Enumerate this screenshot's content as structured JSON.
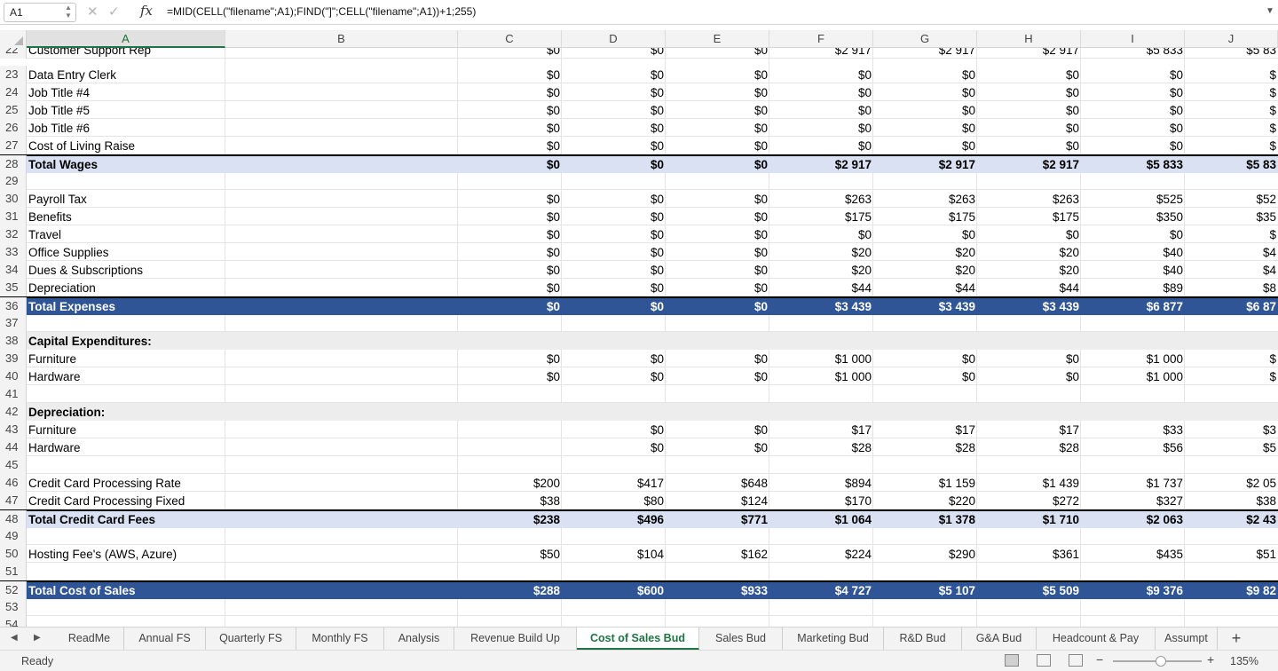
{
  "formula_bar": {
    "cell_ref": "A1",
    "formula": "=MID(CELL(\"filename\";A1);FIND(\"]\";CELL(\"filename\";A1))+1;255)",
    "cancel_icon": "close-icon",
    "enter_icon": "check-icon",
    "fx": "fx"
  },
  "columns": [
    "A",
    "B",
    "C",
    "D",
    "E",
    "F",
    "G",
    "H",
    "I",
    "J"
  ],
  "rows": [
    {
      "num": "22",
      "label": "Customer Support Rep",
      "style": "partial",
      "values": [
        "$0",
        "$0",
        "$0",
        "$2 917",
        "$2 917",
        "$2 917",
        "$5 833",
        "$5 83"
      ]
    },
    {
      "num": "23",
      "label": "Data Entry Clerk",
      "style": "plain",
      "values": [
        "$0",
        "$0",
        "$0",
        "$0",
        "$0",
        "$0",
        "$0",
        "$"
      ]
    },
    {
      "num": "24",
      "label": "Job Title #4",
      "style": "plain",
      "values": [
        "$0",
        "$0",
        "$0",
        "$0",
        "$0",
        "$0",
        "$0",
        "$"
      ]
    },
    {
      "num": "25",
      "label": "Job Title #5",
      "style": "plain",
      "values": [
        "$0",
        "$0",
        "$0",
        "$0",
        "$0",
        "$0",
        "$0",
        "$"
      ]
    },
    {
      "num": "26",
      "label": "Job Title #6",
      "style": "plain",
      "values": [
        "$0",
        "$0",
        "$0",
        "$0",
        "$0",
        "$0",
        "$0",
        "$"
      ]
    },
    {
      "num": "27",
      "label": "Cost of Living Raise",
      "style": "plain",
      "values": [
        "$0",
        "$0",
        "$0",
        "$0",
        "$0",
        "$0",
        "$0",
        "$"
      ]
    },
    {
      "num": "28",
      "label": "Total Wages",
      "style": "light",
      "values": [
        "$0",
        "$0",
        "$0",
        "$2 917",
        "$2 917",
        "$2 917",
        "$5 833",
        "$5 83"
      ]
    },
    {
      "num": "29",
      "label": "",
      "style": "plain",
      "values": [
        "",
        "",
        "",
        "",
        "",
        "",
        "",
        ""
      ]
    },
    {
      "num": "30",
      "label": "Payroll Tax",
      "style": "plain",
      "values": [
        "$0",
        "$0",
        "$0",
        "$263",
        "$263",
        "$263",
        "$525",
        "$52"
      ]
    },
    {
      "num": "31",
      "label": "Benefits",
      "style": "plain",
      "values": [
        "$0",
        "$0",
        "$0",
        "$175",
        "$175",
        "$175",
        "$350",
        "$35"
      ]
    },
    {
      "num": "32",
      "label": "Travel",
      "style": "plain",
      "values": [
        "$0",
        "$0",
        "$0",
        "$0",
        "$0",
        "$0",
        "$0",
        "$"
      ]
    },
    {
      "num": "33",
      "label": "Office Supplies",
      "style": "plain",
      "values": [
        "$0",
        "$0",
        "$0",
        "$20",
        "$20",
        "$20",
        "$40",
        "$4"
      ]
    },
    {
      "num": "34",
      "label": "Dues & Subscriptions",
      "style": "plain",
      "values": [
        "$0",
        "$0",
        "$0",
        "$20",
        "$20",
        "$20",
        "$40",
        "$4"
      ]
    },
    {
      "num": "35",
      "label": "Depreciation",
      "style": "plain",
      "values": [
        "$0",
        "$0",
        "$0",
        "$44",
        "$44",
        "$44",
        "$89",
        "$8"
      ]
    },
    {
      "num": "36",
      "label": "Total Expenses",
      "style": "dark",
      "values": [
        "$0",
        "$0",
        "$0",
        "$3 439",
        "$3 439",
        "$3 439",
        "$6 877",
        "$6 87"
      ]
    },
    {
      "num": "37",
      "label": "",
      "style": "plain",
      "values": [
        "",
        "",
        "",
        "",
        "",
        "",
        "",
        ""
      ]
    },
    {
      "num": "38",
      "label": "Capital Expenditures:",
      "style": "capex",
      "values": [
        "",
        "",
        "",
        "",
        "",
        "",
        "",
        ""
      ]
    },
    {
      "num": "39",
      "label": "Furniture",
      "style": "plain",
      "values": [
        "$0",
        "$0",
        "$0",
        "$1 000",
        "$0",
        "$0",
        "$1 000",
        "$"
      ]
    },
    {
      "num": "40",
      "label": "Hardware",
      "style": "plain",
      "values": [
        "$0",
        "$0",
        "$0",
        "$1 000",
        "$0",
        "$0",
        "$1 000",
        "$"
      ]
    },
    {
      "num": "41",
      "label": "",
      "style": "plain",
      "values": [
        "",
        "",
        "",
        "",
        "",
        "",
        "",
        ""
      ]
    },
    {
      "num": "42",
      "label": "Depreciation:",
      "style": "capex",
      "values": [
        "",
        "",
        "",
        "",
        "",
        "",
        "",
        ""
      ]
    },
    {
      "num": "43",
      "label": "Furniture",
      "style": "plain",
      "values": [
        "",
        "$0",
        "$0",
        "$17",
        "$17",
        "$17",
        "$33",
        "$3"
      ]
    },
    {
      "num": "44",
      "label": "Hardware",
      "style": "plain",
      "values": [
        "",
        "$0",
        "$0",
        "$28",
        "$28",
        "$28",
        "$56",
        "$5"
      ]
    },
    {
      "num": "45",
      "label": "",
      "style": "plain",
      "values": [
        "",
        "",
        "",
        "",
        "",
        "",
        "",
        ""
      ]
    },
    {
      "num": "46",
      "label": "Credit Card Processing Rate",
      "style": "plain",
      "values": [
        "$200",
        "$417",
        "$648",
        "$894",
        "$1 159",
        "$1 439",
        "$1 737",
        "$2 05"
      ]
    },
    {
      "num": "47",
      "label": "Credit Card Processing Fixed",
      "style": "plain",
      "values": [
        "$38",
        "$80",
        "$124",
        "$170",
        "$220",
        "$272",
        "$327",
        "$38"
      ]
    },
    {
      "num": "48",
      "label": "Total Credit Card Fees",
      "style": "light",
      "values": [
        "$238",
        "$496",
        "$771",
        "$1 064",
        "$1 378",
        "$1 710",
        "$2 063",
        "$2 43"
      ]
    },
    {
      "num": "49",
      "label": "",
      "style": "plain",
      "values": [
        "",
        "",
        "",
        "",
        "",
        "",
        "",
        ""
      ]
    },
    {
      "num": "50",
      "label": "Hosting Fee's (AWS, Azure)",
      "style": "plain",
      "values": [
        "$50",
        "$104",
        "$162",
        "$224",
        "$290",
        "$361",
        "$435",
        "$51"
      ]
    },
    {
      "num": "51",
      "label": "",
      "style": "plain",
      "values": [
        "",
        "",
        "",
        "",
        "",
        "",
        "",
        ""
      ]
    },
    {
      "num": "52",
      "label": "Total Cost of Sales",
      "style": "dark",
      "values": [
        "$288",
        "$600",
        "$933",
        "$4 727",
        "$5 107",
        "$5 509",
        "$9 376",
        "$9 82"
      ]
    },
    {
      "num": "53",
      "label": "",
      "style": "plain",
      "values": [
        "",
        "",
        "",
        "",
        "",
        "",
        "",
        ""
      ]
    },
    {
      "num": "54",
      "label": "",
      "style": "plain",
      "values": [
        "",
        "",
        "",
        "",
        "",
        "",
        "",
        ""
      ]
    }
  ],
  "sheet_tabs": [
    "ReadMe",
    "Annual FS",
    "Quarterly FS",
    "Monthly FS",
    "Analysis",
    "Revenue Build Up",
    "Cost of Sales Bud",
    "Sales Bud",
    "Marketing Bud",
    "R&D Bud",
    "G&A Bud",
    "Headcount & Pay",
    "Assumpt"
  ],
  "active_tab": "Cost of Sales Bud",
  "add_sheet": "+",
  "status": {
    "text": "Ready",
    "zoom": "135%",
    "zoom_minus": "−",
    "zoom_plus": "+"
  }
}
